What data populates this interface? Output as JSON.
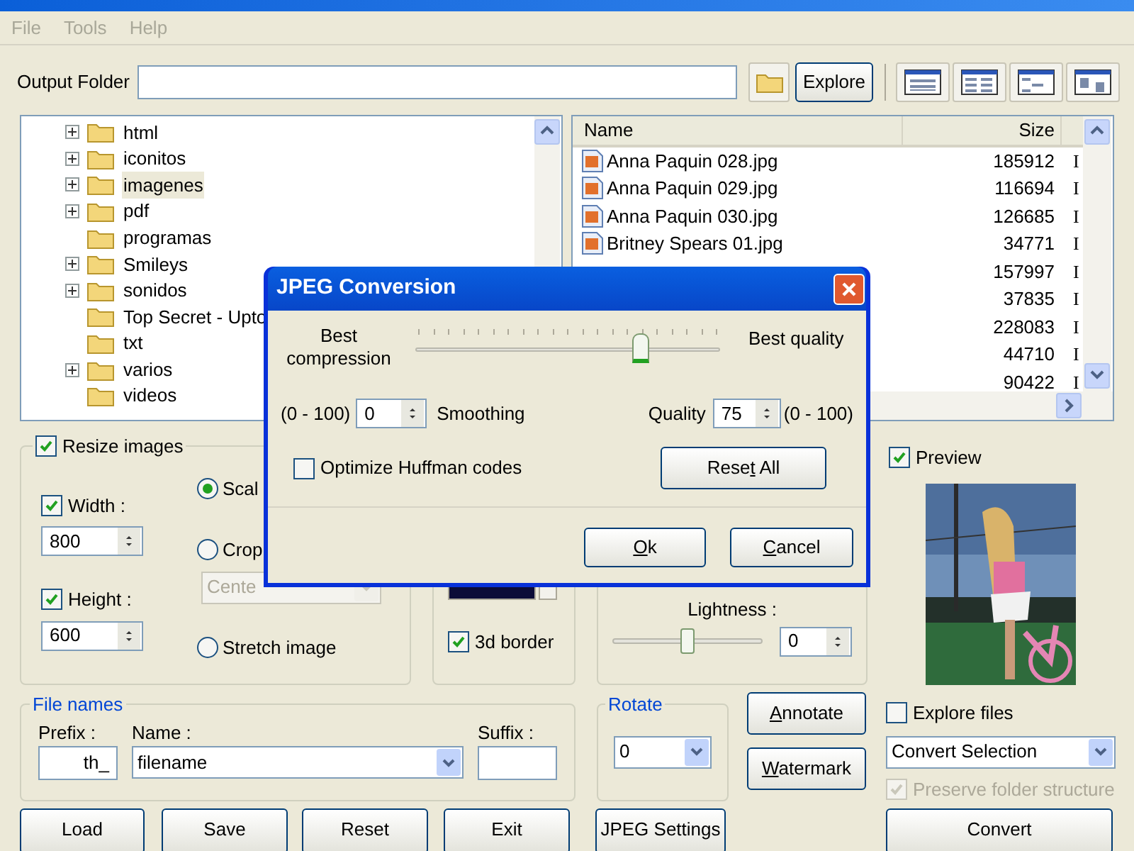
{
  "menu": [
    "File",
    "Tools",
    "Help"
  ],
  "output_folder": {
    "label": "Output Folder"
  },
  "explore_button": "Explore",
  "folder_tree": [
    {
      "label": "html",
      "expandable": true,
      "selected": false
    },
    {
      "label": "iconitos",
      "expandable": true,
      "selected": false
    },
    {
      "label": "imagenes",
      "expandable": true,
      "selected": true
    },
    {
      "label": "pdf",
      "expandable": true,
      "selected": false
    },
    {
      "label": "programas",
      "expandable": false,
      "selected": false
    },
    {
      "label": "Smileys",
      "expandable": true,
      "selected": false
    },
    {
      "label": "sonidos",
      "expandable": true,
      "selected": false
    },
    {
      "label": "Top Secret - Upto",
      "expandable": false,
      "selected": false
    },
    {
      "label": "txt",
      "expandable": false,
      "selected": false
    },
    {
      "label": "varios",
      "expandable": true,
      "selected": false
    },
    {
      "label": "videos",
      "expandable": false,
      "selected": false
    }
  ],
  "file_list": {
    "columns": [
      "Name",
      "Size"
    ],
    "rows": [
      {
        "name": "Anna Paquin 028.jpg",
        "size": "185912",
        "column_3": "I"
      },
      {
        "name": "Anna Paquin 029.jpg",
        "size": "116694",
        "column_3": "I"
      },
      {
        "name": "Anna Paquin 030.jpg",
        "size": "126685",
        "column_3": "I"
      },
      {
        "name": "Britney Spears 01.jpg",
        "size": "34771",
        "column_3": "I"
      },
      {
        "size": "157997",
        "column_3": "I"
      },
      {
        "size": "37835",
        "column_3": "I"
      },
      {
        "size": "228083",
        "column_3": "I"
      },
      {
        "size": "44710",
        "column_3": "I"
      },
      {
        "size": "90422",
        "column_3": "I"
      }
    ]
  },
  "resize": {
    "label": "Resize images",
    "checked": true,
    "width": {
      "label": "Width :",
      "checked": true,
      "value": "800"
    },
    "height": {
      "label": "Height :",
      "checked": true,
      "value": "600"
    },
    "modes": [
      {
        "label": "Scal",
        "selected": true
      },
      {
        "label": "Crop",
        "selected": false
      },
      {
        "label": "Stretch image",
        "selected": false
      }
    ],
    "crop_anchor": {
      "value": "Cente",
      "disabled": true
    }
  },
  "border": {
    "label": "3d border",
    "checked": true
  },
  "lightness": {
    "label": "Lightness :",
    "level": 0.5,
    "value": "0"
  },
  "preview": {
    "label": "Preview",
    "checked": true
  },
  "file_names": {
    "title": "File names",
    "prefix": {
      "label": "Prefix :",
      "value": "th_"
    },
    "name": {
      "label": "Name :",
      "value": "filename"
    },
    "suffix": {
      "label": "Suffix :"
    }
  },
  "rotate": {
    "title": "Rotate",
    "value": "0"
  },
  "side_buttons": [
    {
      "access_key": "A",
      "label_end": "nnotate"
    },
    {
      "access_key": "W",
      "label_end": "atermark"
    }
  ],
  "explore_files": {
    "label": "Explore files",
    "checked": false
  },
  "action": {
    "value": "Convert Selection"
  },
  "preserve": {
    "label": "Preserve folder structure",
    "checked": true,
    "disabled": true
  },
  "bottom_buttons": [
    "Load",
    "Save",
    "Reset",
    "Exit",
    "JPEG Settings",
    "Convert"
  ],
  "dialog": {
    "title": "JPEG Conversion",
    "slider": {
      "min_label": "Best compression",
      "max_label": "Best quality",
      "level": 0.74
    },
    "smoothing": {
      "range": "(0 - 100)",
      "value": "0",
      "label": "Smoothing"
    },
    "quality": {
      "label": "Quality",
      "value": "75",
      "range": "(0 - 100)"
    },
    "optimize": {
      "label": "Optimize Huffman codes",
      "checked": false
    },
    "reset_button": {
      "label_start": "Rese",
      "access_key": "t",
      "label_end": " All"
    },
    "ok_button": {
      "access_key": "O",
      "label_end": "k"
    },
    "cancel_button": {
      "access_key": "C",
      "label_end": "ancel"
    }
  }
}
